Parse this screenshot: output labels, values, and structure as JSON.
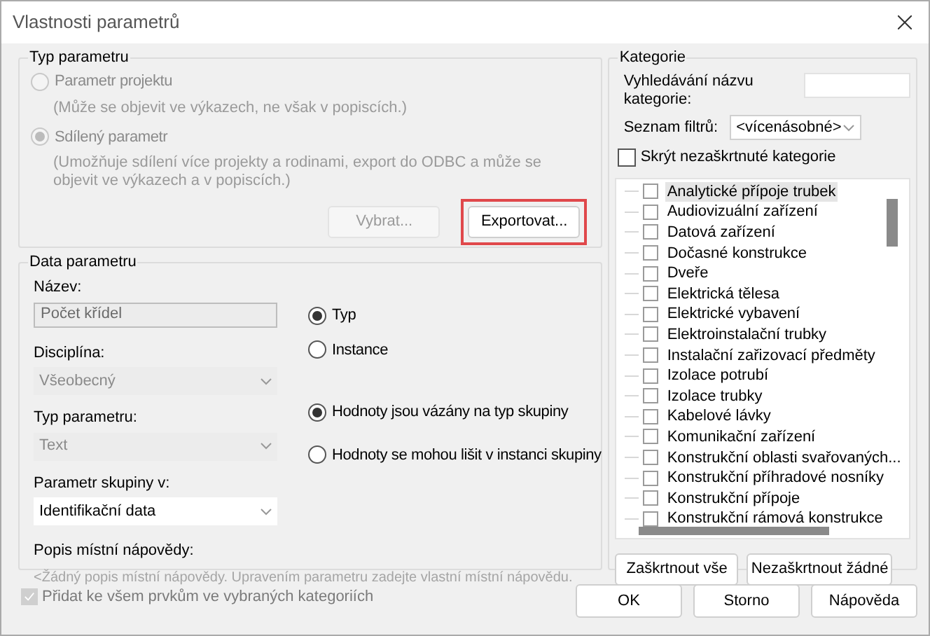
{
  "window": {
    "title": "Vlastnosti parametrů"
  },
  "parameter_type": {
    "title": "Typ parametru",
    "options": [
      {
        "label": "Parametr projektu",
        "note": "(Může se objevit ve výkazech, ne však v popiscích.)",
        "selected": false
      },
      {
        "label": "Sdílený parametr",
        "note": "(Umožňuje sdílení více projekty a rodinami, export do ODBC a může se objevit ve výkazech a v popiscích.)",
        "selected": true
      }
    ],
    "buttons": [
      {
        "label": "Vybrat...",
        "disabled": true,
        "highlighted": false
      },
      {
        "label": "Exportovat...",
        "disabled": false,
        "highlighted": true
      }
    ]
  },
  "parameter_data": {
    "title": "Data parametru",
    "name": {
      "label": "Název:",
      "value": "Počet křídel"
    },
    "discipline": {
      "label": "Disciplína:",
      "value": "Všeobecný",
      "disabled": true
    },
    "type": {
      "label": "Typ parametru:",
      "value": "Text",
      "disabled": true
    },
    "group": {
      "label": "Parametr skupiny v:",
      "value": "Identifikační data",
      "disabled": false
    },
    "tooltip": {
      "label": "Popis místní nápovědy:",
      "text": "<Žádný popis místní nápovědy. Upravením parametru zadejte vlastní místní nápovědu."
    },
    "binding": [
      {
        "label": "Typ",
        "selected": true
      },
      {
        "label": "Instance",
        "selected": false
      }
    ],
    "group_values": [
      {
        "label": "Hodnoty jsou vázány na typ skupiny",
        "selected": true
      },
      {
        "label": "Hodnoty se mohou lišit v instanci skupiny",
        "selected": false
      }
    ]
  },
  "add_to_all": {
    "label": "Přidat ke všem prvkům ve vybraných kategoriích",
    "checked": true,
    "disabled": true
  },
  "categories": {
    "title": "Kategorie",
    "search_label": "Vyhledávání názvu kategorie:",
    "filter_label": "Seznam filtrů:",
    "filter_value": "<vícenásobné>",
    "hide_unchecked": {
      "label": "Skrýt nezaškrtnuté kategorie",
      "checked": false
    },
    "items": [
      {
        "label": "Analytické přípoje trubek",
        "checked": false,
        "selected": true
      },
      {
        "label": "Audiovizuální zařízení",
        "checked": false,
        "selected": false
      },
      {
        "label": "Datová zařízení",
        "checked": false,
        "selected": false
      },
      {
        "label": "Dočasné konstrukce",
        "checked": false,
        "selected": false
      },
      {
        "label": "Dveře",
        "checked": false,
        "selected": false
      },
      {
        "label": "Elektrická tělesa",
        "checked": false,
        "selected": false
      },
      {
        "label": "Elektrické vybavení",
        "checked": false,
        "selected": false
      },
      {
        "label": "Elektroinstalační trubky",
        "checked": false,
        "selected": false
      },
      {
        "label": "Instalační zařizovací předměty",
        "checked": false,
        "selected": false
      },
      {
        "label": "Izolace potrubí",
        "checked": false,
        "selected": false
      },
      {
        "label": "Izolace trubky",
        "checked": false,
        "selected": false
      },
      {
        "label": "Kabelové lávky",
        "checked": false,
        "selected": false
      },
      {
        "label": "Komunikační zařízení",
        "checked": false,
        "selected": false
      },
      {
        "label": "Konstrukční oblasti svařovaných...",
        "checked": false,
        "selected": false
      },
      {
        "label": "Konstrukční příhradové nosníky",
        "checked": false,
        "selected": false
      },
      {
        "label": "Konstrukční přípoje",
        "checked": false,
        "selected": false
      },
      {
        "label": "Konstrukční rámová konstrukce",
        "checked": false,
        "selected": false
      }
    ],
    "buttons": [
      "Zaškrtnout vše",
      "Nezaškrtnout žádné"
    ]
  },
  "footer_buttons": [
    "OK",
    "Storno",
    "Nápověda"
  ]
}
